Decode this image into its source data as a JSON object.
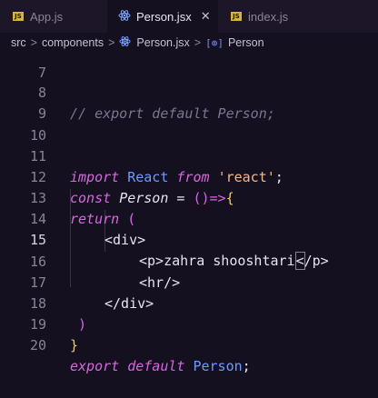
{
  "tabs": [
    {
      "label": "App.js",
      "badge": "JS",
      "icon": "js-file-icon"
    },
    {
      "label": "Person.jsx",
      "icon": "react-icon",
      "close": "✕"
    },
    {
      "label": "index.js",
      "badge": "JS",
      "icon": "js-file-icon"
    }
  ],
  "breadcrumb": {
    "items": [
      "src",
      "components",
      "Person.jsx",
      "Person"
    ],
    "separator": ">"
  },
  "editor": {
    "line_numbers": [
      "7",
      "8",
      "9",
      "10",
      "11",
      "12",
      "13",
      "14",
      "15",
      "16",
      "17",
      "18",
      "19",
      "20"
    ],
    "line8": "// export default Person;",
    "line11": {
      "import": "import",
      "react": "React",
      "from": "from",
      "str": "'react'",
      "semi": ";"
    },
    "line12": {
      "const": "const",
      "name": "Person",
      "eq": " = ",
      "paren": "()",
      "arrow": "=>",
      "brace": "{"
    },
    "line13": {
      "ret": "return",
      "paren": "("
    },
    "line14": "<div>",
    "line15": {
      "open": "<p>",
      "text": "zahra shooshtari",
      "close_lt": "<",
      "close_rest": "/p>"
    },
    "line16": "<hr/>",
    "line17": "</div>",
    "line18": ")",
    "line19": "}",
    "line20": {
      "export": "export",
      "def": "default",
      "name": "Person",
      "semi": ";"
    }
  },
  "colors": {
    "background": "#14101f",
    "keyword": "#d667e0",
    "identifier": "#6d9cff",
    "string": "#f3b98d",
    "comment": "#7e7491"
  }
}
